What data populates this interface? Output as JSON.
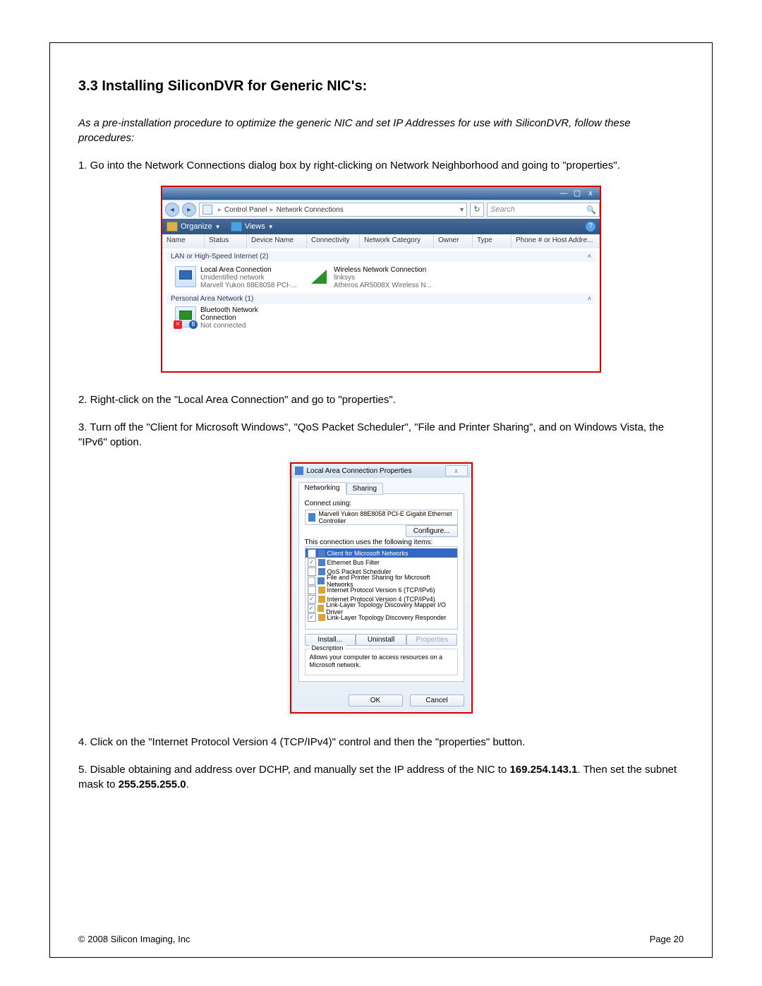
{
  "heading": "3.3  Installing SiliconDVR for Generic NIC's:",
  "intro": "As a pre-installation procedure to optimize the generic NIC and set IP Addresses for use with SiliconDVR, follow these procedures:",
  "step1": "1. Go into the Network Connections dialog box by right-clicking on Network Neighborhood and going to \"properties\".",
  "step2": "2. Right-click on the \"Local Area Connection\" and go to \"properties\".",
  "step3": "3. Turn off the \"Client for Microsoft Windows\", \"QoS Packet Scheduler\", \"File and Printer Sharing\", and on Windows Vista, the \"IPv6\" option.",
  "step4": "4. Click on the \"Internet Protocol Version 4 (TCP/IPv4)\" control and then the \"properties\" button.",
  "step5_a": "5. Disable obtaining and address over DCHP, and manually set the IP address of the NIC to ",
  "step5_ip": "169.254.143.1",
  "step5_b": ".  Then set the subnet mask to ",
  "step5_mask": "255.255.255.0",
  "step5_c": ".",
  "footer_left": "© 2008 Silicon Imaging, Inc",
  "footer_right": "Page 20",
  "win1": {
    "crumb1": "Control Panel",
    "crumb2": "Network Connections",
    "search_placeholder": "Search",
    "organize": "Organize",
    "views": "Views",
    "columns": {
      "name": "Name",
      "status": "Status",
      "device": "Device Name",
      "conn": "Connectivity",
      "cat": "Network Category",
      "owner": "Owner",
      "type": "Type",
      "phone": "Phone # or Host Addre..."
    },
    "group1": "LAN or High-Speed Internet (2)",
    "group2": "Personal Area Network (1)",
    "lan": {
      "name": "Local Area Connection",
      "l2": "Unidentified network",
      "l3": "Marvell Yukon 88E8058 PCI-..."
    },
    "wlan": {
      "name": "Wireless Network Connection",
      "l2": "linksys",
      "l3": "Atheros AR5008X Wireless N..."
    },
    "bt": {
      "name": "Bluetooth Network",
      "l2": "Connection",
      "l3": "Not connected"
    }
  },
  "win2": {
    "title": "Local Area Connection Properties",
    "tab1": "Networking",
    "tab2": "Sharing",
    "connect_using": "Connect using:",
    "adapter": "Marvell Yukon 88E8058 PCI-E Gigabit Ethernet Controller",
    "configure": "Configure...",
    "uses": "This connection uses the following items:",
    "items": [
      {
        "c": false,
        "t": "Client for Microsoft Networks"
      },
      {
        "c": true,
        "t": "Ethernet Bus Filter"
      },
      {
        "c": false,
        "t": "QoS Packet Scheduler"
      },
      {
        "c": false,
        "t": "File and Printer Sharing for Microsoft Networks"
      },
      {
        "c": false,
        "t": "Internet Protocol Version 6 (TCP/IPv6)"
      },
      {
        "c": true,
        "t": "Internet Protocol Version 4 (TCP/IPv4)"
      },
      {
        "c": true,
        "t": "Link-Layer Topology Discovery Mapper I/O Driver"
      },
      {
        "c": true,
        "t": "Link-Layer Topology Discovery Responder"
      }
    ],
    "install": "Install...",
    "uninstall": "Uninstall",
    "properties": "Properties",
    "desc_legend": "Description",
    "desc": "Allows your computer to access resources on a Microsoft network.",
    "ok": "OK",
    "cancel": "Cancel"
  }
}
